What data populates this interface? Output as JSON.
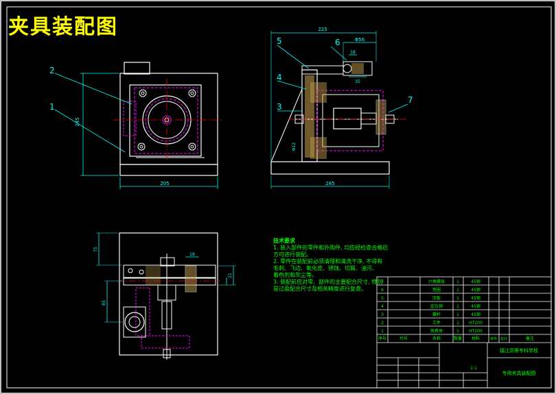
{
  "title": "夹具装配图",
  "callouts": [
    "1",
    "2",
    "3",
    "4",
    "5",
    "6",
    "7"
  ],
  "dims": {
    "width_front": "205",
    "height_front": "245",
    "width_side": "285",
    "top_overall": "225",
    "top_detail": "Φ56",
    "d_18": "18",
    "d_35": "35",
    "d_bottom_x": "75",
    "d_bottom_y": "85",
    "d_bottom_18": "18",
    "d_bottom_21": "21",
    "d_phi12": "Φ12"
  },
  "notes": {
    "heading": "技术要求",
    "lines": [
      "1. 装入部件的零件和外购件, 均应经检查合格后",
      "方可进行装配。",
      "2. 零件在装配前必须清理和清洗干净, 不得有",
      "毛刺、飞边、氧化皮、锈蚀、切屑、油污、",
      "着色剂和灰尘等。",
      "3. 装配前应对零、部件的主要配合尺寸, 特别",
      "是过盈配合尺寸及相关精度进行复查。"
    ]
  },
  "bom": {
    "rows": [
      {
        "no": "7",
        "name": "六角螺母",
        "qty": "1",
        "mat": "45钢"
      },
      {
        "no": "6",
        "name": "垫圈",
        "qty": "1",
        "mat": "45钢"
      },
      {
        "no": "5",
        "name": "压板",
        "qty": "1",
        "mat": "45钢"
      },
      {
        "no": "4",
        "name": "定位销",
        "qty": "1",
        "mat": "45钢"
      },
      {
        "no": "3",
        "name": "螺杆",
        "qty": "1",
        "mat": "45钢"
      },
      {
        "no": "2",
        "name": "工件",
        "qty": "1",
        "mat": "HT200"
      },
      {
        "no": "1",
        "name": "夹具体",
        "qty": "1",
        "mat": "HT200"
      }
    ],
    "header": [
      "序号",
      "代号",
      "名称",
      "数量",
      "材料",
      "单件",
      "总计",
      "备注"
    ],
    "school": "镇江高等专科学校",
    "drawing_name": "专用夹具装配图",
    "sheet": "1:1"
  },
  "colors": {
    "bg": "#000000",
    "frame": "#ffffff",
    "part": "#ffffff",
    "hidden": "#ff00ff",
    "dim": "#00ffff",
    "hatch": "#c8a050",
    "notes": "#00ff00",
    "title": "#ffff00"
  }
}
